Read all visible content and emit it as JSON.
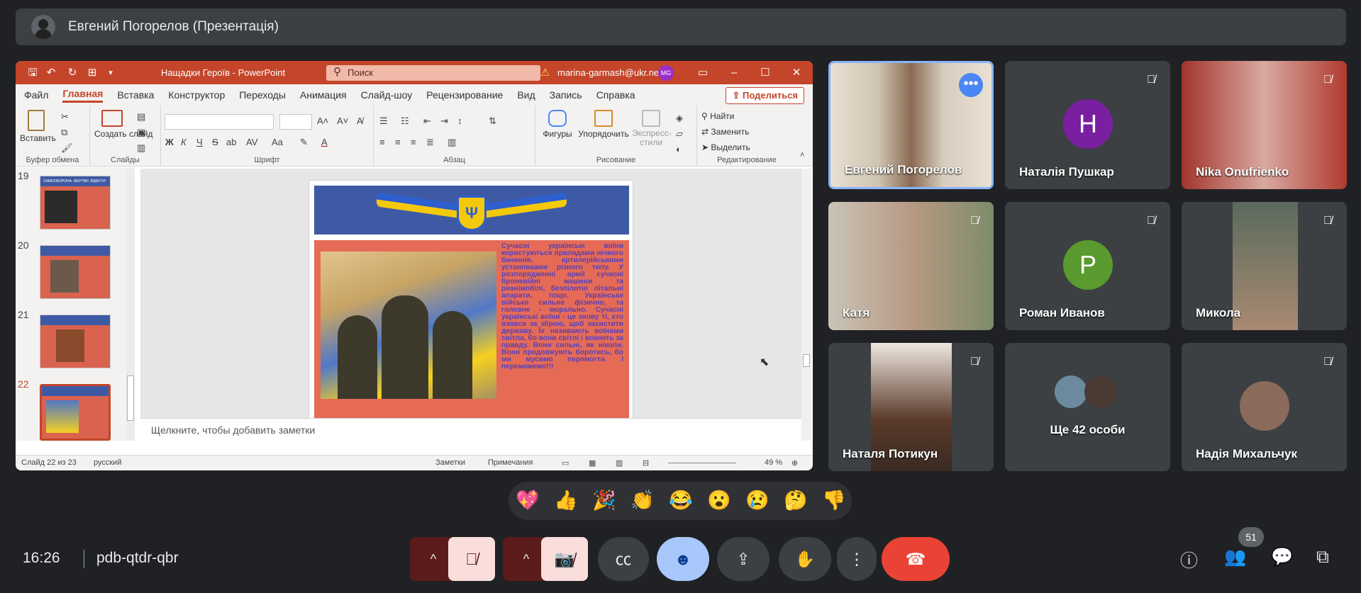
{
  "presenter_bar": {
    "title": "Евгений Погорелов (Презентація)"
  },
  "ppt": {
    "doc_title": "Нащадки Героїв - PowerPoint",
    "search_placeholder": "Поиск",
    "account": "marina-garmash@ukr.net",
    "account_initials": "MG",
    "tabs": [
      "Файл",
      "Главная",
      "Вставка",
      "Конструктор",
      "Переходы",
      "Анимация",
      "Слайд-шоу",
      "Рецензирование",
      "Вид",
      "Запись",
      "Справка"
    ],
    "active_tab": "Главная",
    "share_label": "Поделиться",
    "ribbon": {
      "paste": "Вставить",
      "new_slide": "Создать слайд",
      "shapes": "Фигуры",
      "arrange": "Упорядочить",
      "express": "Экспресс-стили",
      "find": "Найти",
      "replace": "Заменить",
      "select": "Выделить",
      "groups": [
        "Буфер обмена",
        "Слайды",
        "Шрифт",
        "Абзац",
        "Рисование",
        "Редактирование"
      ],
      "font_tools": [
        "Ж",
        "К",
        "Ч",
        "S",
        "ab",
        "AV",
        "Aa"
      ]
    },
    "thumbs": [
      {
        "num": "19",
        "caption": "САМООБОРОНА. ЖЕРТВИ. ВІДБУТИ"
      },
      {
        "num": "20"
      },
      {
        "num": "21"
      },
      {
        "num": "22"
      }
    ],
    "slide_text": "Сучасні українські воїни користуються приладами нічного бачення, артилерійськими установками різного типу. У розпорядженні армії сучасні броневійні машини та реанімобілі, безпілотні літальні апарати, тощо. Українське військо сильне фізично, та головне - морально. Сучасні українські воїни - це знову ті, хто взявся за зброю, щоб захистити державу. Їх називають воїнами світла, бо вони світлі і воюють за правду. Вони сильні, як ніколи. Вони продовжують боротись, бо ми мусимо перемогти. І переможемо!!!",
    "notes_placeholder": "Щелкните, чтобы добавить заметки",
    "status": {
      "slide": "Слайд 22 из 23",
      "lang": "русский",
      "notes": "Заметки",
      "comments": "Примечания",
      "zoom": "49 %"
    }
  },
  "tiles": [
    {
      "name": "Евгений Погорелов"
    },
    {
      "name": "Наталія Пушкар",
      "initial": "H",
      "color": "#7b1fa2"
    },
    {
      "name": "Nika Onufrienko"
    },
    {
      "name": "Катя"
    },
    {
      "name": "Роман Иванов",
      "initial": "P",
      "color": "#5a9a2e"
    },
    {
      "name": "Микола"
    },
    {
      "name": "Наталя Потикун"
    },
    {
      "name": "Ще 42 особи"
    },
    {
      "name": "Надія Михальчук"
    }
  ],
  "reactions": [
    "💖",
    "👍",
    "🎉",
    "👏",
    "😂",
    "😮",
    "😢",
    "🤔",
    "👎"
  ],
  "bottom": {
    "time": "16:26",
    "meeting_code": "pdb-qtdr-qbr",
    "participants_count": "51"
  },
  "colors": {
    "accent": "#c4452a",
    "end_call": "#ea4335",
    "reactions_on": "#a8c7fa"
  }
}
